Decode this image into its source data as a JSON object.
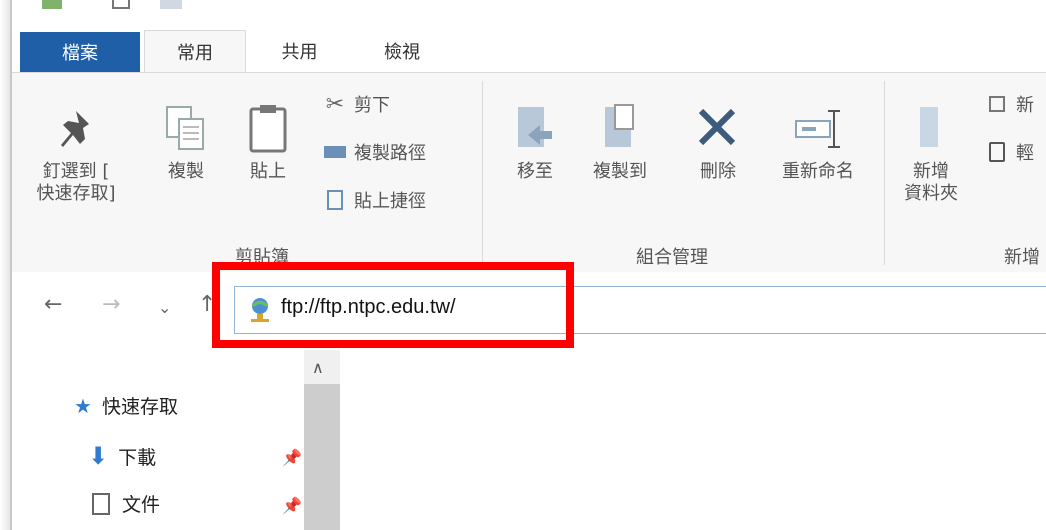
{
  "tabs": {
    "file": "檔案",
    "home": "常用",
    "share": "共用",
    "view": "檢視"
  },
  "clipboard": {
    "pin": "釘選到 [\n快速存取]",
    "copy": "複製",
    "paste": "貼上",
    "cut": "剪下",
    "copy_path": "複製路徑",
    "paste_shortcut": "貼上捷徑",
    "label": "剪貼簿"
  },
  "organize": {
    "move_to": "移至",
    "copy_to": "複製到",
    "delete": "刪除",
    "rename": "重新命名",
    "label": "組合管理"
  },
  "new": {
    "new_folder": "新增\n資料夾",
    "new_item": "新",
    "easy_access": "輕",
    "label": "新增"
  },
  "address": {
    "value": "ftp://ftp.ntpc.edu.tw/"
  },
  "navpane": {
    "quick_access": "快速存取",
    "downloads": "下載",
    "documents": "文件"
  },
  "colors": {
    "accent": "#1f5fa8",
    "highlight": "#ff0000"
  }
}
